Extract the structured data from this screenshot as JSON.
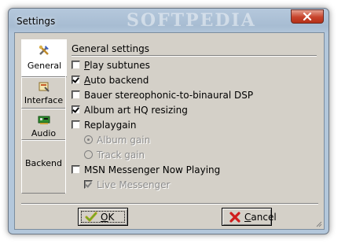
{
  "window": {
    "title": "Settings",
    "watermark": "SOFTPEDIA",
    "close_icon": "close-icon"
  },
  "tabs": [
    {
      "label": "General",
      "icon": "general-tools-icon",
      "active": true
    },
    {
      "label": "Interface",
      "icon": "interface-icon",
      "active": false
    },
    {
      "label": "Audio",
      "icon": "audio-card-icon",
      "active": false
    },
    {
      "label": "Backend",
      "icon": "",
      "active": false
    }
  ],
  "general": {
    "group_title": "General settings",
    "options": [
      {
        "type": "checkbox",
        "label": "Play subtunes",
        "accel": "P",
        "rest": "lay subtunes",
        "checked": false,
        "enabled": true
      },
      {
        "type": "checkbox",
        "label": "Auto backend",
        "accel": "A",
        "rest": "uto backend",
        "checked": true,
        "enabled": true
      },
      {
        "type": "checkbox",
        "label": "Bauer stereophonic-to-binaural DSP",
        "checked": false,
        "enabled": true
      },
      {
        "type": "checkbox",
        "label": "Album art HQ resizing",
        "checked": true,
        "enabled": true
      },
      {
        "type": "checkbox",
        "label": "Replaygain",
        "checked": false,
        "enabled": true
      },
      {
        "type": "radio",
        "label": "Album gain",
        "selected": true,
        "enabled": false
      },
      {
        "type": "radio",
        "label": "Track gain",
        "selected": false,
        "enabled": false
      },
      {
        "type": "checkbox",
        "label": "MSN Messenger Now Playing",
        "checked": false,
        "enabled": true
      },
      {
        "type": "checkbox",
        "label": "Live Messenger",
        "checked": true,
        "enabled": false
      }
    ]
  },
  "buttons": {
    "ok": {
      "label": "OK",
      "accel": "O",
      "rest": "K",
      "icon": "checkmark-icon"
    },
    "cancel": {
      "label": "Cancel",
      "accel": "C",
      "rest": "ancel",
      "icon": "red-x-icon"
    }
  },
  "colors": {
    "titlebar": "#a7bcd2",
    "client": "#d4d0c8",
    "close": "#c7432b"
  }
}
